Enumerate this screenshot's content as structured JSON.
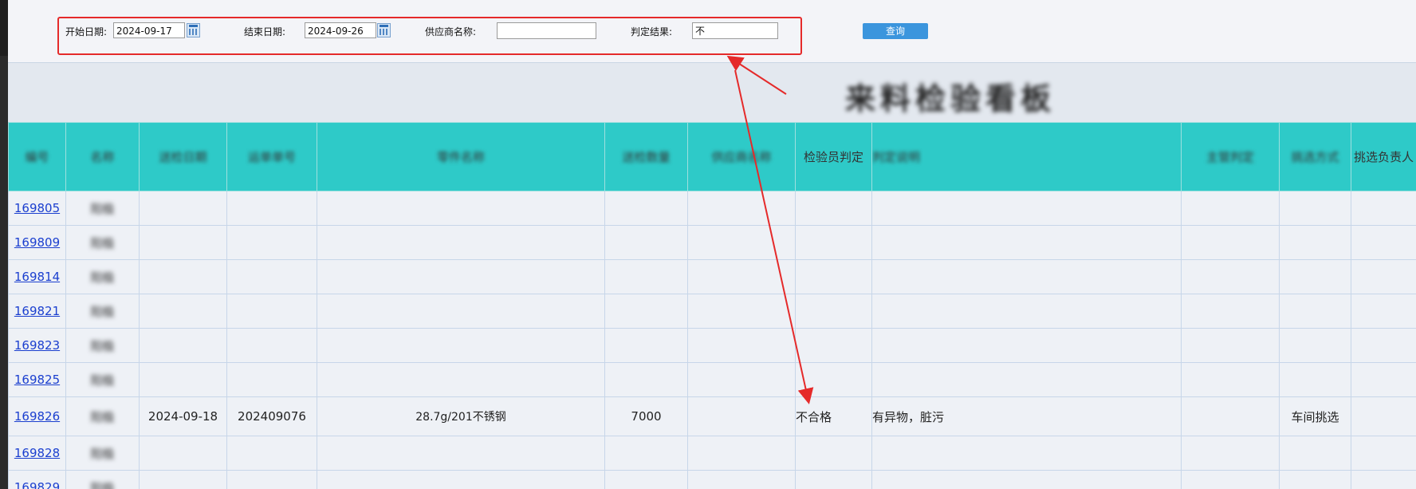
{
  "filters": {
    "start_label": "开始日期:",
    "start_value": "2024-09-17",
    "end_label": "结束日期:",
    "end_value": "2024-09-26",
    "supplier_label": "供应商名称:",
    "supplier_value": "",
    "result_label": "判定结果:",
    "result_value": "不",
    "query_button": "查询"
  },
  "board_title": "来料检验看板",
  "table": {
    "headers": [
      "编号",
      "名称",
      "送检日期",
      "运单单号",
      "零件名称",
      "送检数量",
      "供应商名称",
      "检验员判定",
      "判定说明",
      "主管判定",
      "挑选方式",
      "挑选负责人"
    ],
    "rows": [
      {
        "id": "169805",
        "name": "阳极",
        "date": "",
        "waybill": "",
        "part": "",
        "qty": "",
        "supplier": "",
        "inspector": "",
        "desc": "",
        "supervisor": "",
        "method": "",
        "owner": ""
      },
      {
        "id": "169809",
        "name": "阳极",
        "date": "",
        "waybill": "",
        "part": "",
        "qty": "",
        "supplier": "",
        "inspector": "",
        "desc": "",
        "supervisor": "",
        "method": "",
        "owner": ""
      },
      {
        "id": "169814",
        "name": "阳极",
        "date": "",
        "waybill": "",
        "part": "",
        "qty": "",
        "supplier": "",
        "inspector": "",
        "desc": "",
        "supervisor": "",
        "method": "",
        "owner": ""
      },
      {
        "id": "169821",
        "name": "阳极",
        "date": "",
        "waybill": "",
        "part": "",
        "qty": "",
        "supplier": "",
        "inspector": "",
        "desc": "",
        "supervisor": "",
        "method": "",
        "owner": ""
      },
      {
        "id": "169823",
        "name": "阳极",
        "date": "",
        "waybill": "",
        "part": "",
        "qty": "",
        "supplier": "",
        "inspector": "",
        "desc": "",
        "supervisor": "",
        "method": "",
        "owner": ""
      },
      {
        "id": "169825",
        "name": "阳极",
        "date": "",
        "waybill": "",
        "part": "",
        "qty": "",
        "supplier": "",
        "inspector": "",
        "desc": "",
        "supervisor": "",
        "method": "",
        "owner": ""
      },
      {
        "id": "169826",
        "name": "阳极",
        "date": "2024-09-18",
        "waybill": "202409076",
        "part": "28.7g/201不锈钢",
        "qty": "7000",
        "supplier": "",
        "inspector": "不合格",
        "desc": "有异物，脏污",
        "supervisor": "",
        "method": "车间挑选",
        "owner": ""
      },
      {
        "id": "169828",
        "name": "阳极",
        "date": "",
        "waybill": "",
        "part": "",
        "qty": "",
        "supplier": "",
        "inspector": "",
        "desc": "",
        "supervisor": "",
        "method": "",
        "owner": ""
      },
      {
        "id": "169829",
        "name": "阳极",
        "date": "",
        "waybill": "",
        "part": "",
        "qty": "",
        "supplier": "",
        "inspector": "",
        "desc": "",
        "supervisor": "",
        "method": "",
        "owner": ""
      }
    ]
  },
  "colors": {
    "header_bg": "#2ecac8",
    "annotation": "#e52a2a",
    "link": "#1b3fcf",
    "query_button": "#3b95dd"
  },
  "icons": [
    "calendar-icon"
  ]
}
